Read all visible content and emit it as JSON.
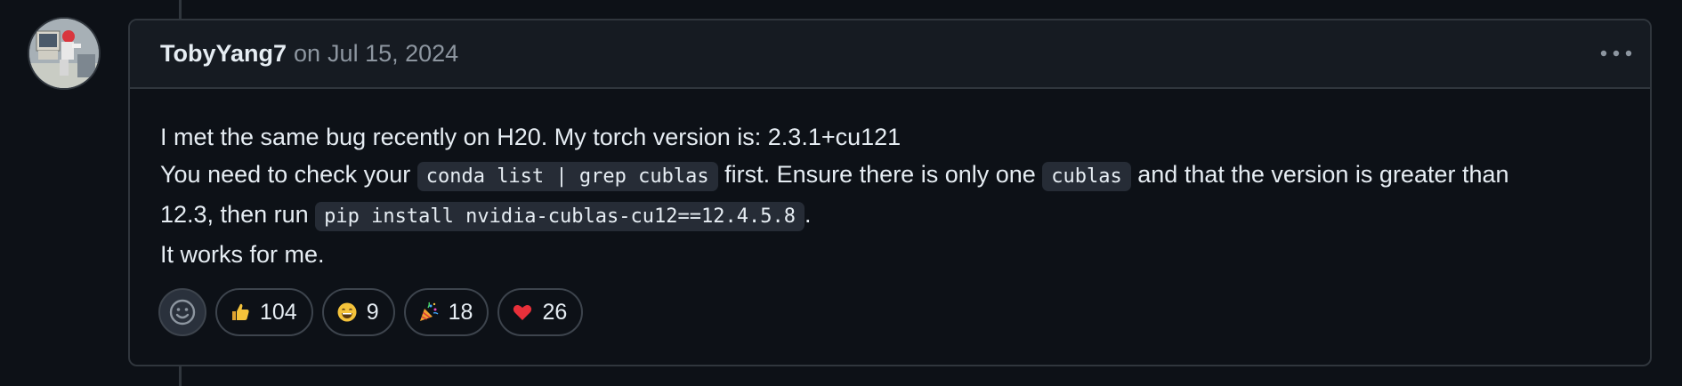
{
  "comment": {
    "author": "TobyYang7",
    "date_prefix": "on",
    "date": "Jul 15, 2024",
    "body": {
      "line1": "I met the same bug recently on H20. My torch version is: 2.3.1+cu121",
      "line2_a": "You need to check your ",
      "line2_code1": "conda list | grep cublas",
      "line2_b": " first. Ensure there is only one ",
      "line2_code2": "cublas",
      "line2_c": " and that the version is greater than",
      "line3_a": "12.3, then run ",
      "line3_code": "pip install nvidia-cublas-cu12==12.4.5.8",
      "line3_b": ".",
      "line4": "It works for me."
    },
    "reactions": [
      {
        "icon": "thumbs-up-icon",
        "count": "104"
      },
      {
        "icon": "laugh-icon",
        "count": "9"
      },
      {
        "icon": "hooray-icon",
        "count": "18"
      },
      {
        "icon": "heart-icon",
        "count": "26"
      }
    ]
  },
  "colors": {
    "background": "#0d1117",
    "header": "#161b22",
    "border": "#30363d",
    "muted_text": "#8d96a0",
    "code_bg": "#262c36"
  }
}
